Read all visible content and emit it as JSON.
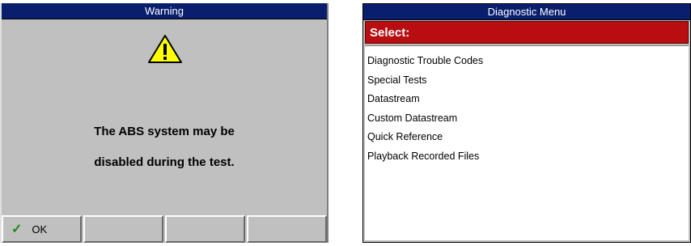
{
  "warning": {
    "title": "Warning",
    "icon": "warning-triangle-icon",
    "message_line1": "The ABS system may be",
    "message_line2": "disabled during the test.",
    "buttons": [
      {
        "label": "OK",
        "icon": "checkmark-icon"
      },
      {
        "label": ""
      },
      {
        "label": ""
      },
      {
        "label": ""
      }
    ]
  },
  "diagnostic_menu": {
    "title": "Diagnostic Menu",
    "select_label": "Select:",
    "items": [
      "Diagnostic Trouble Codes",
      "Special Tests",
      "Datastream",
      "Custom Datastream",
      "Quick Reference",
      "Playback Recorded Files"
    ]
  },
  "colors": {
    "titlebar": "#0a1e6e",
    "select_bar": "#b80e12",
    "panel": "#c0c0c0",
    "warning_yellow": "#ffff00",
    "check_green": "#1a8a1a"
  }
}
